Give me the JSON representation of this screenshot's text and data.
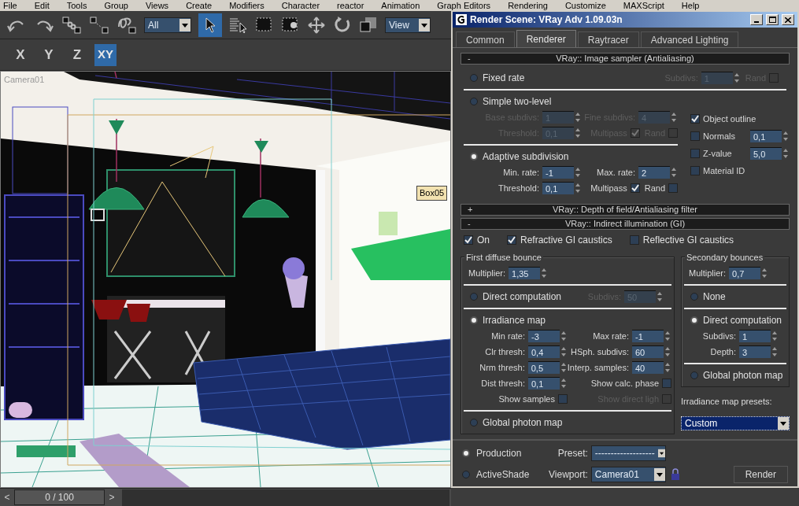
{
  "menu_bar": [
    "File",
    "Edit",
    "Tools",
    "Group",
    "Views",
    "Create",
    "Modifiers",
    "Character",
    "reactor",
    "Animation",
    "Graph Editors",
    "Rendering",
    "Customize",
    "MAXScript",
    "Help"
  ],
  "toolbar": {
    "selection_filter": "All",
    "reference_coordinate_system": "View",
    "select_object_active": true
  },
  "axis_constraints": [
    {
      "label": "X",
      "selected": false
    },
    {
      "label": "Y",
      "selected": false
    },
    {
      "label": "Z",
      "selected": false
    },
    {
      "label": "XY",
      "selected": true
    }
  ],
  "viewport": {
    "label": "Camera01",
    "object_tag": "Box05"
  },
  "timeline": {
    "previous": "<",
    "frame": "0 / 100",
    "next": ">",
    "level": 0
  },
  "dialog": {
    "title": "Render Scene: VRay Adv 1.09.03n",
    "tabs": [
      {
        "label": "Common",
        "selected": false
      },
      {
        "label": "Renderer",
        "selected": true
      },
      {
        "label": "Raytracer",
        "selected": false
      },
      {
        "label": "Advanced Lighting",
        "selected": false
      }
    ],
    "image_sampler": {
      "toggle": "-",
      "title": "VRay:: Image sampler (Antialiasing)",
      "modes": [
        {
          "label": "Fixed rate",
          "selected": false,
          "inline": [
            {
              "kind": "spinner",
              "label": "Subdivs:",
              "value": "1",
              "disabled": true
            },
            {
              "kind": "check_trailing",
              "label": "Rand",
              "checked": false,
              "disabled": true
            }
          ]
        },
        {
          "label": "Simple two-level",
          "selected": false,
          "rows": [
            [
              {
                "kind": "spinner",
                "label": "Base subdivs:",
                "value": "1",
                "disabled": true
              },
              {
                "kind": "spinner",
                "label": "Fine subdivs:",
                "value": "4",
                "disabled": true
              }
            ],
            [
              {
                "kind": "spinner",
                "label": "Threshold:",
                "value": "0,1",
                "disabled": true
              },
              {
                "kind": "check_trailing",
                "label": "Multipass",
                "checked": true,
                "disabled": true
              },
              {
                "kind": "check_trailing",
                "label": "Rand",
                "checked": false,
                "disabled": true
              }
            ]
          ]
        },
        {
          "label": "Adaptive subdivision",
          "selected": true,
          "rows": [
            [
              {
                "kind": "spinner",
                "label": "Min. rate:",
                "value": "-1",
                "disabled": false
              },
              {
                "kind": "spinner",
                "label": "Max. rate:",
                "value": "2",
                "disabled": false
              }
            ],
            [
              {
                "kind": "spinner",
                "label": "Threshold:",
                "value": "0,1",
                "disabled": false
              },
              {
                "kind": "check_trailing",
                "label": "Multipass",
                "checked": true,
                "disabled": false
              },
              {
                "kind": "check_trailing",
                "label": "Rand",
                "checked": false,
                "disabled": false
              }
            ]
          ]
        }
      ],
      "options": [
        {
          "kind": "check",
          "label": "Object outline",
          "checked": true
        },
        {
          "kind": "check_spinner",
          "label": "Normals",
          "checked": false,
          "value": "0,1"
        },
        {
          "kind": "check_spinner",
          "label": "Z-value",
          "checked": false,
          "value": "5,0"
        },
        {
          "kind": "check",
          "label": "Material ID",
          "checked": false
        }
      ]
    },
    "dof_rollout": {
      "toggle": "+",
      "title": "VRay:: Depth of field/Antialiasing filter"
    },
    "gi_rollout": {
      "toggle": "-",
      "title": "VRay:: Indirect illumination (GI)",
      "switches": [
        {
          "label": "On",
          "checked": true
        },
        {
          "label": "Refractive GI caustics",
          "checked": true
        },
        {
          "label": "Reflective GI caustics",
          "checked": false
        }
      ],
      "first_bounce": {
        "title": "First diffuse bounce",
        "multiplier": {
          "label": "Multiplier:",
          "value": "1,35"
        },
        "methods": [
          {
            "label": "Direct computation",
            "selected": false,
            "inline": [
              {
                "kind": "spinner",
                "label": "Subdivs:",
                "value": "50",
                "disabled": true
              }
            ]
          },
          {
            "label": "Irradiance map",
            "selected": true,
            "rows": [
              [
                {
                  "kind": "spinner",
                  "label": "Min rate:",
                  "value": "-3",
                  "disabled": false
                },
                {
                  "kind": "spinner",
                  "label": "Max rate:",
                  "value": "-1",
                  "disabled": false
                }
              ],
              [
                {
                  "kind": "spinner",
                  "label": "Clr thresh:",
                  "value": "0,4",
                  "disabled": false
                },
                {
                  "kind": "spinner",
                  "label": "HSph. subdivs:",
                  "value": "60",
                  "disabled": false
                }
              ],
              [
                {
                  "kind": "spinner",
                  "label": "Nrm thresh:",
                  "value": "0,5",
                  "disabled": false
                },
                {
                  "kind": "spinner",
                  "label": "Interp. samples:",
                  "value": "40",
                  "disabled": false
                }
              ],
              [
                {
                  "kind": "spinner",
                  "label": "Dist thresh:",
                  "value": "0,1",
                  "disabled": false
                },
                {
                  "kind": "check_trailing",
                  "label": "Show calc. phase",
                  "checked": false,
                  "disabled": false
                }
              ],
              [
                {
                  "kind": "check_trailing",
                  "label": "Show samples",
                  "checked": false,
                  "disabled": false
                },
                {
                  "kind": "check_trailing",
                  "label": "Show direct ligh",
                  "checked": false,
                  "disabled": true
                }
              ]
            ]
          },
          {
            "label": "Global photon map",
            "selected": false
          }
        ]
      },
      "secondary_bounces": {
        "title": "Secondary bounces",
        "multiplier": {
          "label": "Multiplier:",
          "value": "0,7"
        },
        "methods": [
          {
            "label": "None",
            "selected": false
          },
          {
            "label": "Direct computation",
            "selected": true,
            "rows": [
              [
                {
                  "kind": "spinner",
                  "label": "Subdivs:",
                  "value": "1",
                  "disabled": false
                }
              ],
              [
                {
                  "kind": "spinner",
                  "label": "Depth:",
                  "value": "3",
                  "disabled": false
                }
              ]
            ]
          },
          {
            "label": "Global photon map",
            "selected": false
          }
        ]
      },
      "presets": {
        "label": "Irradiance map presets:",
        "value": "Custom"
      }
    },
    "footer": {
      "modes": [
        {
          "label": "Production",
          "selected": true
        },
        {
          "label": "ActiveShade",
          "selected": false
        }
      ],
      "preset": {
        "label": "Preset:",
        "value": "-------------------"
      },
      "viewport": {
        "label": "Viewport:",
        "value": "Camera01"
      },
      "render_button": "Render"
    }
  }
}
